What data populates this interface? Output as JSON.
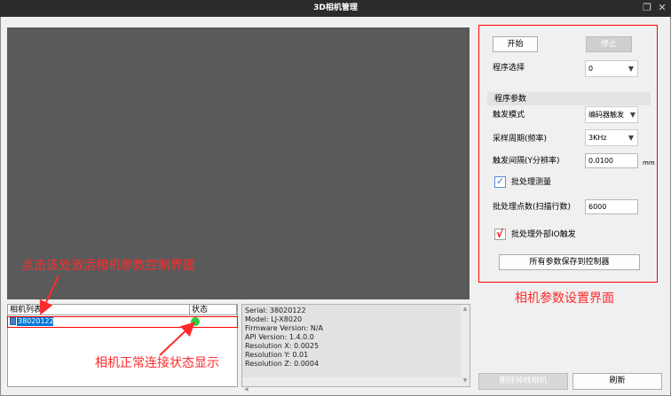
{
  "window": {
    "title": "3D相机管理",
    "restore_glyph": "❐",
    "close_glyph": "✕"
  },
  "camera_list": {
    "header_name": "相机列表",
    "header_status": "状态",
    "rows": [
      {
        "serial": "38020122",
        "status_color": "#2ecc40"
      }
    ]
  },
  "info": {
    "lines": [
      "Serial: 38020122",
      "Model: LJ-X8020",
      "Firmware Version: N/A",
      "API Version: 1.4.0.0",
      "Resolution X: 0.0025",
      "Resolution Y: 0.01",
      "Resolution Z: 0.0004"
    ]
  },
  "settings": {
    "start_label": "开始",
    "stop_label": "停止",
    "program_label": "程序选择",
    "program_value": "0",
    "section_title": "程序参数",
    "trigger_mode_label": "触发模式",
    "trigger_mode_value": "编码器触发",
    "sample_period_label": "采样周期(频率)",
    "sample_period_value": "3KHz",
    "trigger_interval_label": "触发间隔(Y分辨率)",
    "trigger_interval_value": "0.0100",
    "trigger_interval_unit": "mm",
    "batch_label": "批处理测量",
    "batch_points_label": "批处理点数(扫描行数)",
    "batch_points_value": "6000",
    "batch_external_label": "批处理外部IO触发",
    "save_all_label": "所有参数保存到控制器"
  },
  "bottom_buttons": {
    "delete_offline": "删除掉线相机",
    "refresh": "刷新"
  },
  "annotations": {
    "click_hint": "点击该处激活相机参数控制界面",
    "status_hint": "相机正常连接状态显示",
    "settings_hint": "相机参数设置界面"
  },
  "colors": {
    "annotation_red": "#ff2b2b",
    "selection_blue": "#0078d7",
    "status_green": "#2ecc40"
  }
}
